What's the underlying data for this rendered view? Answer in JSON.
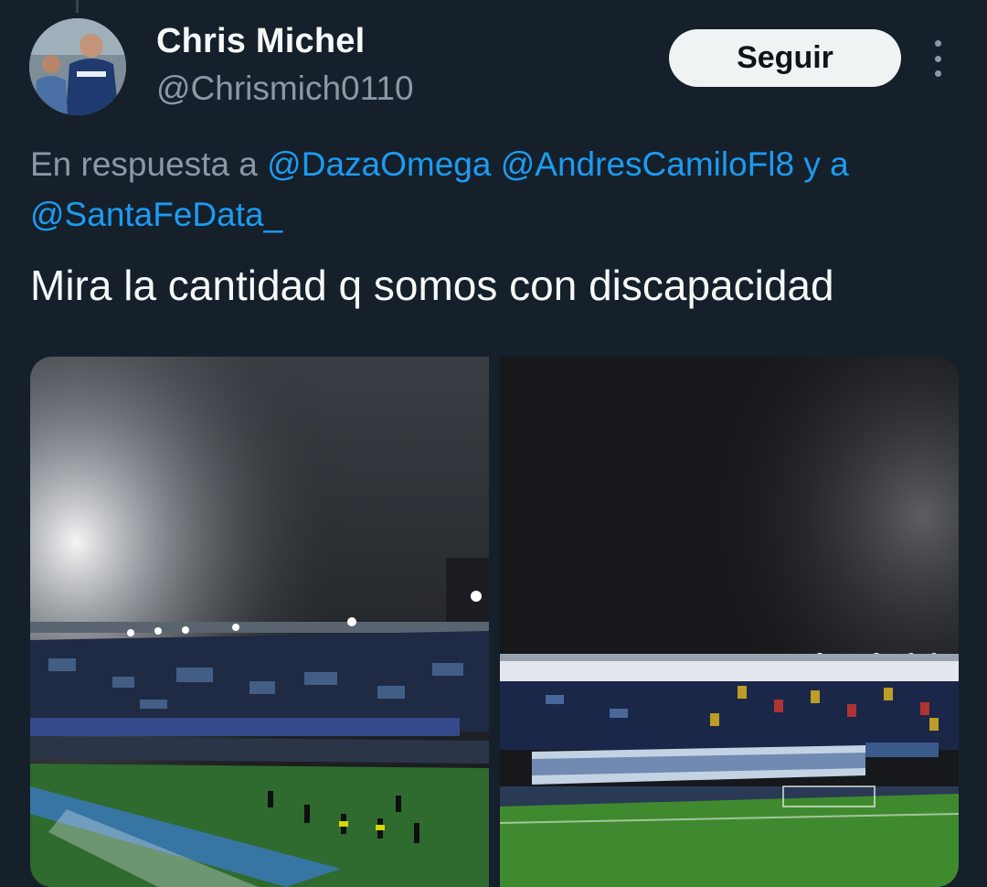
{
  "author": {
    "name": "Chris Michel",
    "handle": "@Chrismich0110"
  },
  "follow_label": "Seguir",
  "reply": {
    "prefix": "En respuesta a",
    "mention1": "@DazaOmega",
    "mention2": "@AndresCamiloFl8",
    "connector": "y a",
    "mention3": "@SantaFeData_"
  },
  "tweet_text": "Mira la cantidad q somos con discapacidad",
  "colors": {
    "background": "#15202b",
    "mention": "#1d9bf0",
    "secondary_text": "#8b98a5",
    "button_bg": "#eff3f4"
  },
  "icons": {
    "more": "more-vertical-icon"
  }
}
